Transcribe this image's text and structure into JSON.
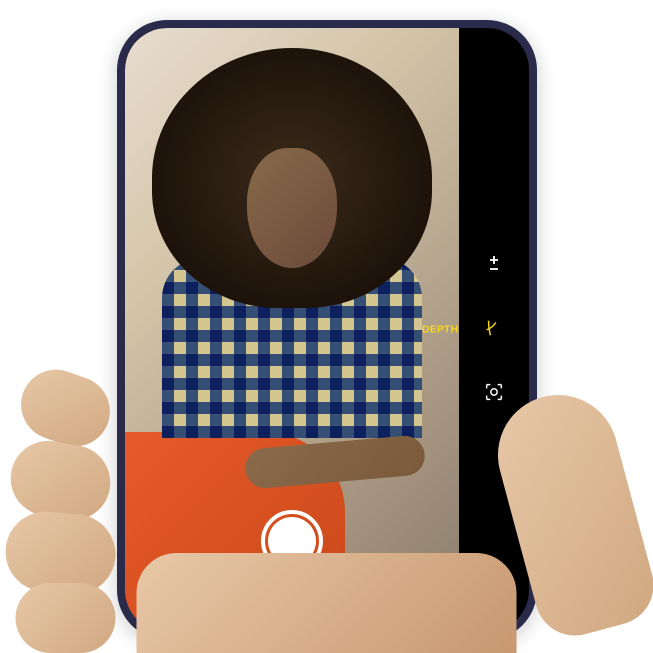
{
  "camera": {
    "depth_label": "DEPTH",
    "controls": {
      "exposure_icon": "exposure",
      "aperture_icon": "aperture",
      "lighting_icon": "lighting"
    }
  },
  "colors": {
    "accent": "#f9d71c",
    "shutter": "#ffffff"
  }
}
